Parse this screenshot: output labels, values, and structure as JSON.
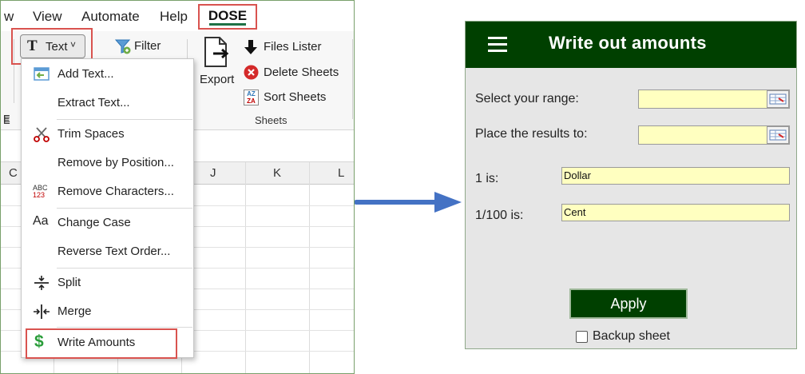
{
  "menubar": {
    "tabs": [
      "w",
      "View",
      "Automate",
      "Help"
    ],
    "active_tab": "DOSE"
  },
  "ribbon": {
    "text_button": {
      "glyph": "T",
      "label": "Text",
      "chevron": "˅"
    },
    "filter_label": "Filter",
    "export_label": "Export",
    "files_lister_label": "Files Lister",
    "delete_sheets_label": "Delete Sheets",
    "sort_sheets_label": "Sort Sheets",
    "sort_glyph_top": "AZ",
    "sort_glyph_bottom": "ZA",
    "sheets_group_label": "Sheets",
    "cut_label_e": "E",
    "cut_label_e2": "E"
  },
  "grid": {
    "column_headers": [
      "C",
      "J",
      "K",
      "L"
    ]
  },
  "dropdown": {
    "items": [
      {
        "label": "Add Text...",
        "icon": "add-text-icon"
      },
      {
        "label": "Extract Text...",
        "icon": ""
      },
      {
        "label": "Trim Spaces",
        "icon": "scissors-icon"
      },
      {
        "label": "Remove by Position...",
        "icon": ""
      },
      {
        "label": "Remove Characters...",
        "icon": "abc-123-icon"
      },
      {
        "label": "Change Case",
        "icon": "change-case-icon"
      },
      {
        "label": "Reverse Text Order...",
        "icon": ""
      },
      {
        "label": "Split",
        "icon": "split-icon"
      },
      {
        "label": "Merge",
        "icon": "merge-icon"
      },
      {
        "label": "Write Amounts",
        "icon": "dollar-icon"
      }
    ],
    "abc_glyph": "ABC",
    "num_glyph": "123",
    "case_glyph": "Aa",
    "dollar_glyph": "$"
  },
  "dialog": {
    "title": "Write out amounts",
    "range_label": "Select your range:",
    "range_value": "",
    "results_label": "Place the results to:",
    "results_value": "",
    "one_label": "1 is:",
    "one_value": "Dollar",
    "hundredth_label": "1/100 is:",
    "hundredth_value": "Cent",
    "apply_label": "Apply",
    "backup_label": "Backup sheet",
    "backup_checked": false
  },
  "colors": {
    "dialog_header": "#004000",
    "input_fill": "#ffffc0",
    "highlight_red": "#d9534f",
    "arrow_blue": "#4472c4"
  }
}
